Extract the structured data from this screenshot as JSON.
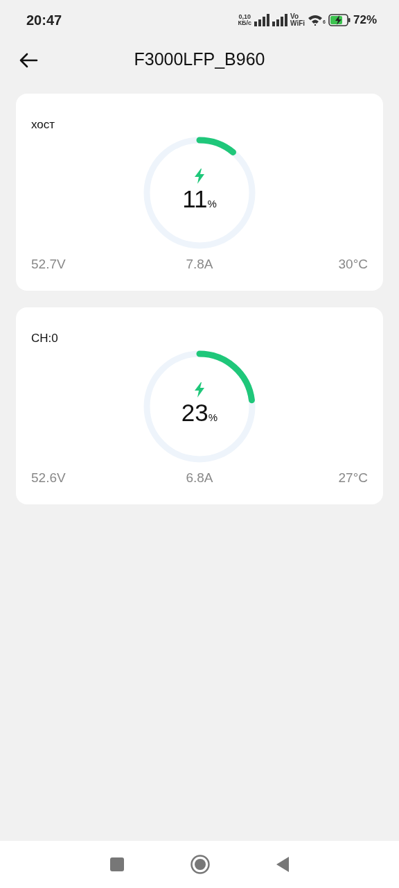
{
  "status_bar": {
    "time": "20:47",
    "speed_value": "0,10",
    "speed_unit": "КБ/с",
    "vowifi_top": "Vo",
    "vowifi_bottom": "WiFi",
    "wifi_badge": "6",
    "battery": "72%"
  },
  "header": {
    "title": "F3000LFP_B960"
  },
  "packs": [
    {
      "name": "хост",
      "charging": true,
      "percent": "11",
      "percent_unit": "%",
      "voltage": "52.7V",
      "current": "7.8A",
      "temperature": "30°C"
    },
    {
      "name": "CH:0",
      "charging": true,
      "percent": "23",
      "percent_unit": "%",
      "voltage": "52.6V",
      "current": "6.8A",
      "temperature": "27°C"
    }
  ]
}
